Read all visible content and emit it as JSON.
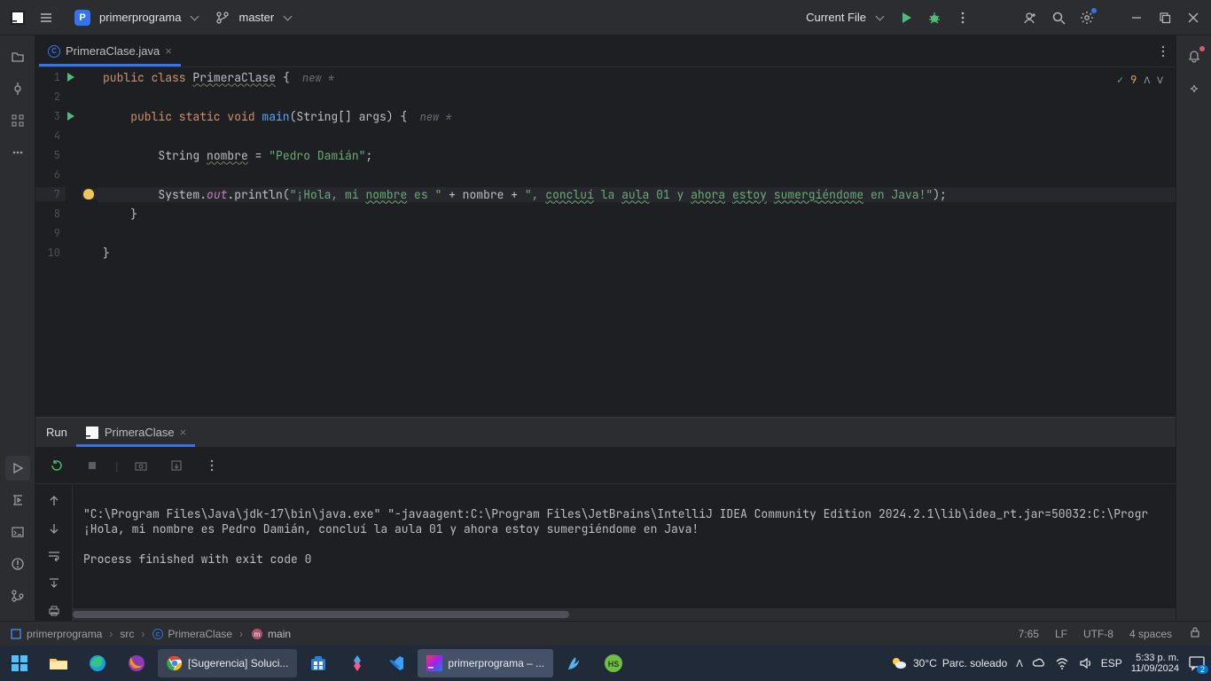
{
  "titlebar": {
    "project_letter": "P",
    "project_name": "primerprograma",
    "branch": "master",
    "run_config": "Current File"
  },
  "editor_tab": {
    "filename": "PrimeraClase.java"
  },
  "editor_corner": {
    "warnings": "9"
  },
  "code": {
    "l1": {
      "kw1": "public ",
      "kw2": "class ",
      "cls": "PrimeraClase",
      "rest": " {",
      "hint": "  new *"
    },
    "l3": {
      "indent": "    ",
      "kw": "public static void ",
      "mtd": "main",
      "args": "(String[] args) {",
      "hint": "  new *"
    },
    "l5": {
      "indent": "        ",
      "type": "String ",
      "var": "nombre",
      "rest": " = ",
      "str": "\"Pedro Damián\"",
      "semi": ";"
    },
    "l7": {
      "indent": "        ",
      "sys": "System.",
      "out": "out",
      "prt": ".println(",
      "s1": "\"¡Hola, mi ",
      "w1": "nombre",
      "s2": " es \"",
      "plus1": " + nombre + ",
      "s3": "\", ",
      "w2": "concluí",
      "sp1": " la ",
      "w3": "aula",
      "sp2": " 01 y ",
      "w4": "ahora",
      "sp3": " ",
      "w5": "estoy",
      "sp4": " ",
      "w6": "sumergiéndome",
      "s4": " en Java!\"",
      "end": ");"
    },
    "l8": "    }",
    "l10": "}"
  },
  "line_numbers": [
    "1",
    "2",
    "3",
    "4",
    "5",
    "6",
    "7",
    "8",
    "9",
    "10"
  ],
  "run_panel": {
    "title": "Run",
    "tab": "PrimeraClase",
    "line1": "\"C:\\Program Files\\Java\\jdk-17\\bin\\java.exe\" \"-javaagent:C:\\Program Files\\JetBrains\\IntelliJ IDEA Community Edition 2024.2.1\\lib\\idea_rt.jar=50032:C:\\Progr",
    "line2": "¡Hola, mi nombre es Pedro Damián, concluí la aula 01 y ahora estoy sumergiéndome en Java!",
    "line3": "Process finished with exit code 0"
  },
  "breadcrumbs": {
    "b1": "primerprograma",
    "b2": "src",
    "b3": "PrimeraClase",
    "b4": "main"
  },
  "status": {
    "pos": "7:65",
    "eol": "LF",
    "enc": "UTF-8",
    "indent": "4 spaces"
  },
  "taskbar": {
    "chrome_label": "[Sugerencia] Soluci...",
    "intellij_label": "primerprograma – ...",
    "weather_temp": "30°C",
    "weather_desc": "Parc. soleado",
    "lang": "ESP",
    "time": "5:33 p. m.",
    "date": "11/09/2024",
    "notif": "2"
  }
}
